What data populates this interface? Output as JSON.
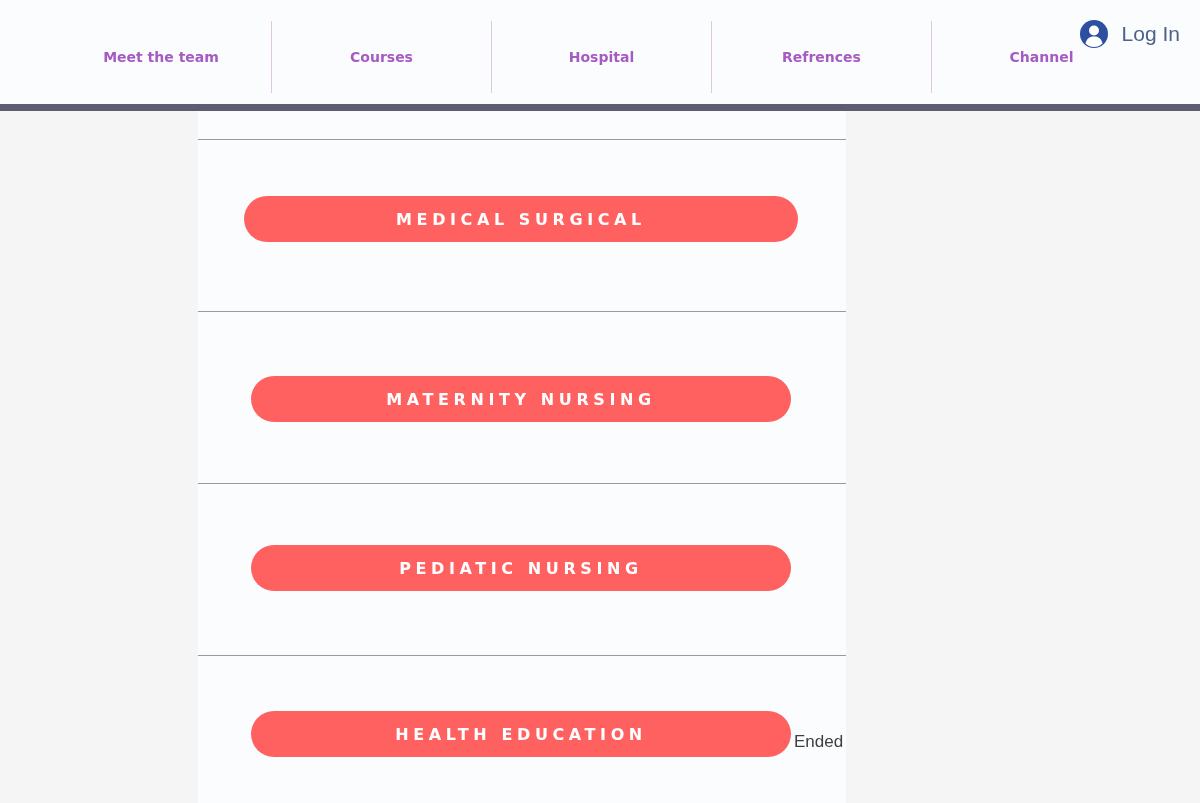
{
  "nav": {
    "items": [
      {
        "label": "Meet the team"
      },
      {
        "label": "Courses"
      },
      {
        "label": "Hospital"
      },
      {
        "label": "Refrences"
      },
      {
        "label": "Channel"
      }
    ]
  },
  "login": {
    "label": "Log In"
  },
  "sections": [
    {
      "button": "MEDICAL SURGICAL"
    },
    {
      "button": "MATERNITY NURSING"
    },
    {
      "button": "PEDIATIC NURSING"
    },
    {
      "button": "HEALTH EDUCATION",
      "status": "Ended"
    }
  ]
}
